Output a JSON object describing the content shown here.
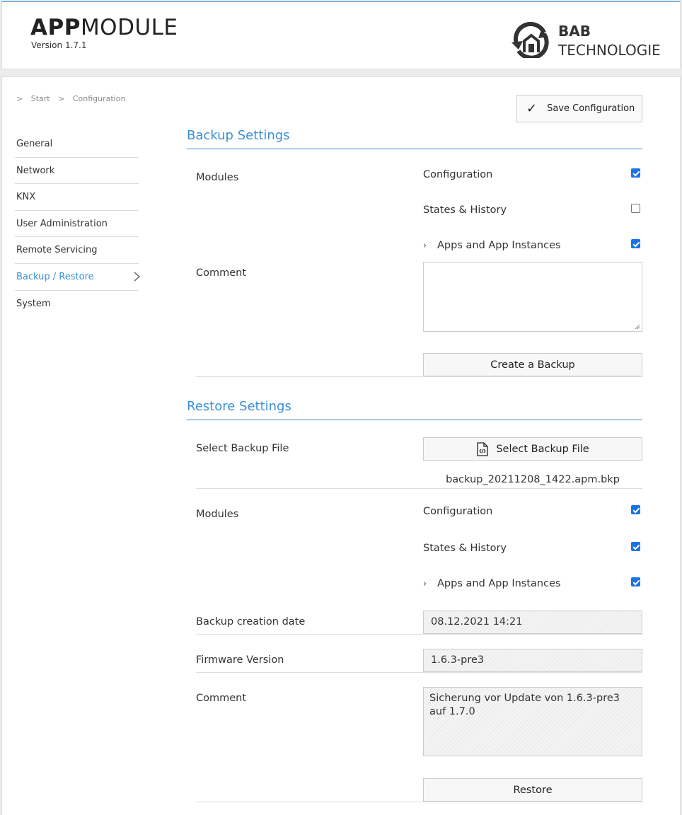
{
  "header": {
    "app_title_bold": "APP",
    "app_title_light": "MODULE",
    "version": "Version 1.7.1",
    "brand_line1": "BAB",
    "brand_line2": "TECHNOLOGIE"
  },
  "breadcrumb": [
    ">",
    "Start",
    ">",
    "Configuration"
  ],
  "nav": {
    "items": [
      {
        "label": "General"
      },
      {
        "label": "Network"
      },
      {
        "label": "KNX"
      },
      {
        "label": "User Administration"
      },
      {
        "label": "Remote Servicing"
      },
      {
        "label": "Backup / Restore",
        "active": true
      },
      {
        "label": "System"
      }
    ]
  },
  "toolbar": {
    "save_label": "Save Configuration"
  },
  "backup": {
    "title": "Backup Settings",
    "modules_label": "Modules",
    "options": [
      {
        "label": "Configuration",
        "checked": true
      },
      {
        "label": "States & History",
        "checked": false
      },
      {
        "label": "Apps and App Instances",
        "checked": true
      }
    ],
    "comment_label": "Comment",
    "comment_value": "",
    "create_button": "Create a Backup"
  },
  "restore": {
    "title": "Restore Settings",
    "select_file_label": "Select Backup File",
    "select_file_button": "Select Backup File",
    "file_name": "backup_20211208_1422.apm.bkp",
    "modules_label": "Modules",
    "options": [
      {
        "label": "Configuration",
        "checked": true
      },
      {
        "label": "States & History",
        "checked": true
      },
      {
        "label": "Apps and App Instances",
        "checked": true
      }
    ],
    "creation_date_label": "Backup creation date",
    "creation_date_value": "08.12.2021 14:21",
    "firmware_label": "Firmware Version",
    "firmware_value": "1.6.3-pre3",
    "comment_label": "Comment",
    "comment_value": "Sicherung vor Update von 1.6.3-pre3 auf 1.7.0",
    "restore_button": "Restore"
  },
  "colors": {
    "accent": "#3a8fd6",
    "checkbox": "#1a73e8"
  }
}
